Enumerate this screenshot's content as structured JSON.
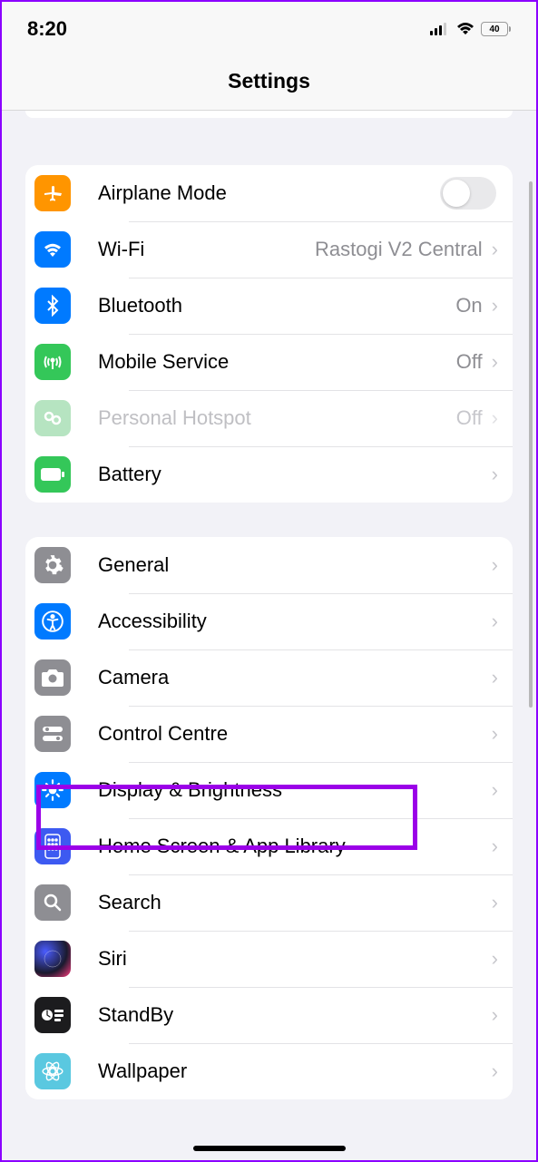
{
  "status": {
    "time": "8:20",
    "battery": "40"
  },
  "header": {
    "title": "Settings"
  },
  "section1": {
    "airplane": {
      "label": "Airplane Mode"
    },
    "wifi": {
      "label": "Wi-Fi",
      "value": "Rastogi V2 Central"
    },
    "bluetooth": {
      "label": "Bluetooth",
      "value": "On"
    },
    "mobile": {
      "label": "Mobile Service",
      "value": "Off"
    },
    "hotspot": {
      "label": "Personal Hotspot",
      "value": "Off"
    },
    "battery": {
      "label": "Battery"
    }
  },
  "section2": {
    "general": {
      "label": "General"
    },
    "accessibility": {
      "label": "Accessibility"
    },
    "camera": {
      "label": "Camera"
    },
    "control": {
      "label": "Control Centre"
    },
    "display": {
      "label": "Display & Brightness"
    },
    "home": {
      "label": "Home Screen & App Library"
    },
    "search": {
      "label": "Search"
    },
    "siri": {
      "label": "Siri"
    },
    "standby": {
      "label": "StandBy"
    },
    "wallpaper": {
      "label": "Wallpaper"
    }
  },
  "colors": {
    "orange": "#ff9500",
    "blue": "#007aff",
    "green": "#34c759",
    "grey": "#8e8e93",
    "lightgreen": "#b6e4c1",
    "black": "#1c1c1e",
    "teal": "#5ac8e0"
  }
}
